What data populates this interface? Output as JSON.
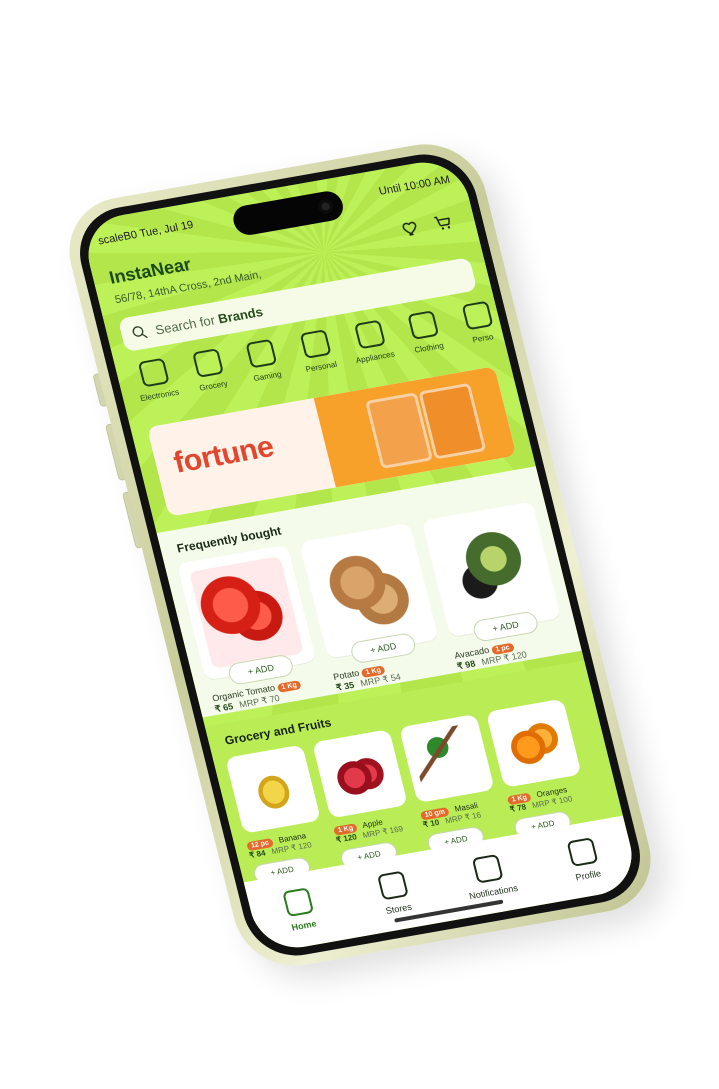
{
  "status": {
    "left": "scaleB0 Tue, Jul 19",
    "right": "Until 10:00 AM"
  },
  "app": {
    "name": "InstaNear",
    "address": "56/78, 14thA Cross, 2nd Main,"
  },
  "icons": {
    "wishlist": "heart-icon",
    "cart": "cart-icon",
    "search": "search-icon"
  },
  "search": {
    "prefix": "Search for",
    "term": "Brands"
  },
  "categories": [
    {
      "label": "Electronics",
      "icon": "headphones-icon"
    },
    {
      "label": "Grocery",
      "icon": "basket-icon"
    },
    {
      "label": "Gaming",
      "icon": "gamepad-icon"
    },
    {
      "label": "Personal",
      "icon": "watch-icon"
    },
    {
      "label": "Appliances",
      "icon": "blender-icon"
    },
    {
      "label": "Clothing",
      "icon": "shirt-icon"
    },
    {
      "label": "Perso",
      "icon": "watch-icon"
    }
  ],
  "banner": {
    "brand": "fortune",
    "colors": {
      "accent": "#e2462f",
      "orange": "#f7a12a"
    }
  },
  "frequently_bought": {
    "title": "Frequently bought",
    "items": [
      {
        "name": "Organic Tomato",
        "badge": "1 Kg",
        "price": "₹ 65",
        "mrp": "MRP ₹ 70",
        "add": "+ ADD",
        "icon": "tomato-image"
      },
      {
        "name": "Potato",
        "badge": "1 Kg",
        "price": "₹ 35",
        "mrp": "MRP ₹ 54",
        "add": "+ ADD",
        "icon": "potato-image"
      },
      {
        "name": "Avacado",
        "badge": "1 pc",
        "price": "₹ 98",
        "mrp": "MRP ₹ 120",
        "add": "+ ADD",
        "icon": "avocado-image"
      }
    ]
  },
  "grocery_and_fruits": {
    "title": "Grocery and Fruits",
    "items": [
      {
        "name": "Banana",
        "badge": "12 pc",
        "price": "₹ 84",
        "mrp": "MRP ₹ 120",
        "add": "+ ADD",
        "icon": "banana-image"
      },
      {
        "name": "Apple",
        "badge": "1 Kg",
        "price": "₹ 120",
        "mrp": "MRP ₹ 169",
        "add": "+ ADD",
        "icon": "apple-image"
      },
      {
        "name": "Masali",
        "badge": "10 gm",
        "price": "₹ 10",
        "mrp": "MRP ₹ 16",
        "add": "+ ADD",
        "icon": "herb-image"
      },
      {
        "name": "Oranges",
        "badge": "1 Kg",
        "price": "₹ 78",
        "mrp": "MRP ₹ 100",
        "add": "+ ADD",
        "icon": "orange-image"
      }
    ]
  },
  "tabs": [
    {
      "label": "Home",
      "icon": "home-icon",
      "active": true
    },
    {
      "label": "Stores",
      "icon": "store-icon",
      "active": false
    },
    {
      "label": "Notifications",
      "icon": "bell-icon",
      "active": false
    },
    {
      "label": "Profile",
      "icon": "user-icon",
      "active": false
    }
  ]
}
